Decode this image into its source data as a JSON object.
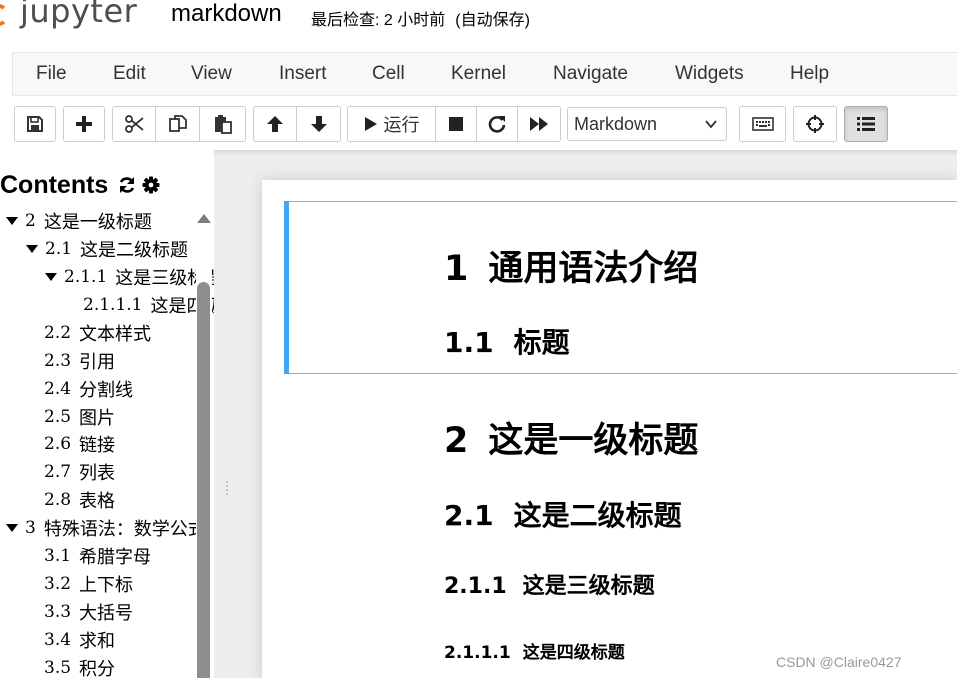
{
  "header": {
    "logo_text": "jupyter",
    "notebook_title": "markdown",
    "last_checkpoint": "最后检查: 2 小时前",
    "autosave_status": "(自动保存)"
  },
  "menubar": {
    "items": [
      "File",
      "Edit",
      "View",
      "Insert",
      "Cell",
      "Kernel",
      "Navigate",
      "Widgets",
      "Help"
    ]
  },
  "toolbar": {
    "run_label": "运行",
    "cell_type_selected": "Markdown",
    "icons": [
      "save-icon",
      "plus-icon",
      "scissors-icon",
      "copy-icon",
      "paste-icon",
      "arrow-up-icon",
      "arrow-down-icon",
      "play-icon",
      "stop-icon",
      "restart-icon",
      "fast-forward-icon",
      "keyboard-icon",
      "crosshairs-icon",
      "list-icon"
    ]
  },
  "toc": {
    "title": "Contents",
    "items": [
      {
        "num": "2",
        "label": "这是一级标题",
        "caret": true
      },
      {
        "num": "2.1",
        "label": "这是二级标题",
        "caret": true
      },
      {
        "num": "2.1.1",
        "label": "这是三级标题",
        "caret": true
      },
      {
        "num": "2.1.1.1",
        "label": "这是四级标题",
        "caret": false
      },
      {
        "num": "2.2",
        "label": "文本样式",
        "caret": false
      },
      {
        "num": "2.3",
        "label": "引用",
        "caret": false
      },
      {
        "num": "2.4",
        "label": "分割线",
        "caret": false
      },
      {
        "num": "2.5",
        "label": "图片",
        "caret": false
      },
      {
        "num": "2.6",
        "label": "链接",
        "caret": false
      },
      {
        "num": "2.7",
        "label": "列表",
        "caret": false
      },
      {
        "num": "2.8",
        "label": "表格",
        "caret": false
      },
      {
        "num": "3",
        "label": "特殊语法：数学公式",
        "caret": true
      },
      {
        "num": "3.1",
        "label": "希腊字母",
        "caret": false
      },
      {
        "num": "3.2",
        "label": "上下标",
        "caret": false
      },
      {
        "num": "3.3",
        "label": "大括号",
        "caret": false
      },
      {
        "num": "3.4",
        "label": "求和",
        "caret": false
      },
      {
        "num": "3.5",
        "label": "积分",
        "caret": false
      }
    ]
  },
  "notebook": {
    "headings": [
      {
        "num": "1",
        "text": "通用语法介绍"
      },
      {
        "num": "1.1",
        "text": "标题"
      },
      {
        "num": "2",
        "text": "这是一级标题"
      },
      {
        "num": "2.1",
        "text": "这是二级标题"
      },
      {
        "num": "2.1.1",
        "text": "这是三级标题"
      },
      {
        "num": "2.1.1.1",
        "text": "这是四级标题"
      }
    ]
  },
  "watermark": "CSDN @Claire0427",
  "colors": {
    "logo_orange": "#f37726",
    "selected_cell_bar": "#42a5f5",
    "menubar_bg": "#f8f8f8",
    "page_bg": "#eeeeee"
  }
}
